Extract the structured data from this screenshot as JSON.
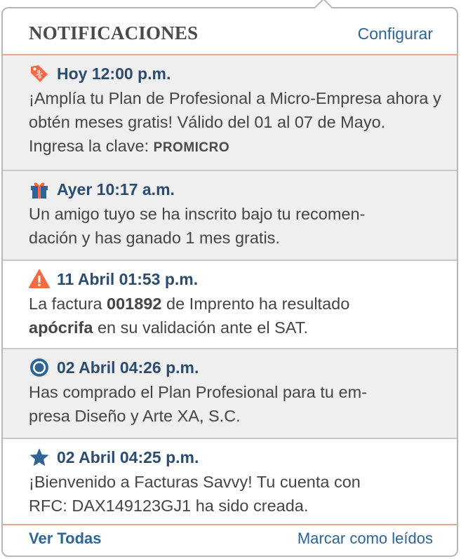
{
  "header": {
    "title": "NOTIFICACIONES",
    "config_label": "Configurar"
  },
  "notifications": [
    {
      "icon": "discount-tag-icon",
      "time": "Hoy 12:00 p.m.",
      "text_before": "¡Amplía tu Plan de Profesional a Micro-Empresa ahora y obtén meses gratis! Válido del 01 al 07 de Mayo. Ingresa la clave: ",
      "code": "PROMICRO"
    },
    {
      "icon": "gift-icon",
      "time": "Ayer 10:17 a.m.",
      "text_line1": "Un amigo tuyo se ha inscrito bajo tu recomen-",
      "text_line2": "dación y has ganado 1 mes gratis."
    },
    {
      "icon": "warning-icon",
      "time": "11 Abril 01:53 p.m.",
      "text_part1": "La factura ",
      "bold1": "001892",
      "text_part2": " de Imprento ha resultado ",
      "bold2": "apócrifa",
      "text_part3": " en su validación ante el SAT."
    },
    {
      "icon": "target-icon",
      "time": "02 Abril 04:26 p.m.",
      "text_line1": "Has comprado el Plan Profesional para tu em-",
      "text_line2": "presa Diseño y Arte XA, S.C."
    },
    {
      "icon": "star-icon",
      "time": "02 Abril 04:25 p.m.",
      "text_line1": "¡Bienvenido a Facturas Savvy! Tu cuenta con",
      "text_line2": "RFC: DAX149123GJ1 ha sido creada."
    }
  ],
  "footer": {
    "view_all_label": "Ver Todas",
    "mark_read_label": "Marcar como leídos"
  },
  "colors": {
    "accent_blue": "#2f6493",
    "title_blue": "#2b4c6f",
    "orange": "#f26b46",
    "divider_orange": "#eea48e"
  }
}
